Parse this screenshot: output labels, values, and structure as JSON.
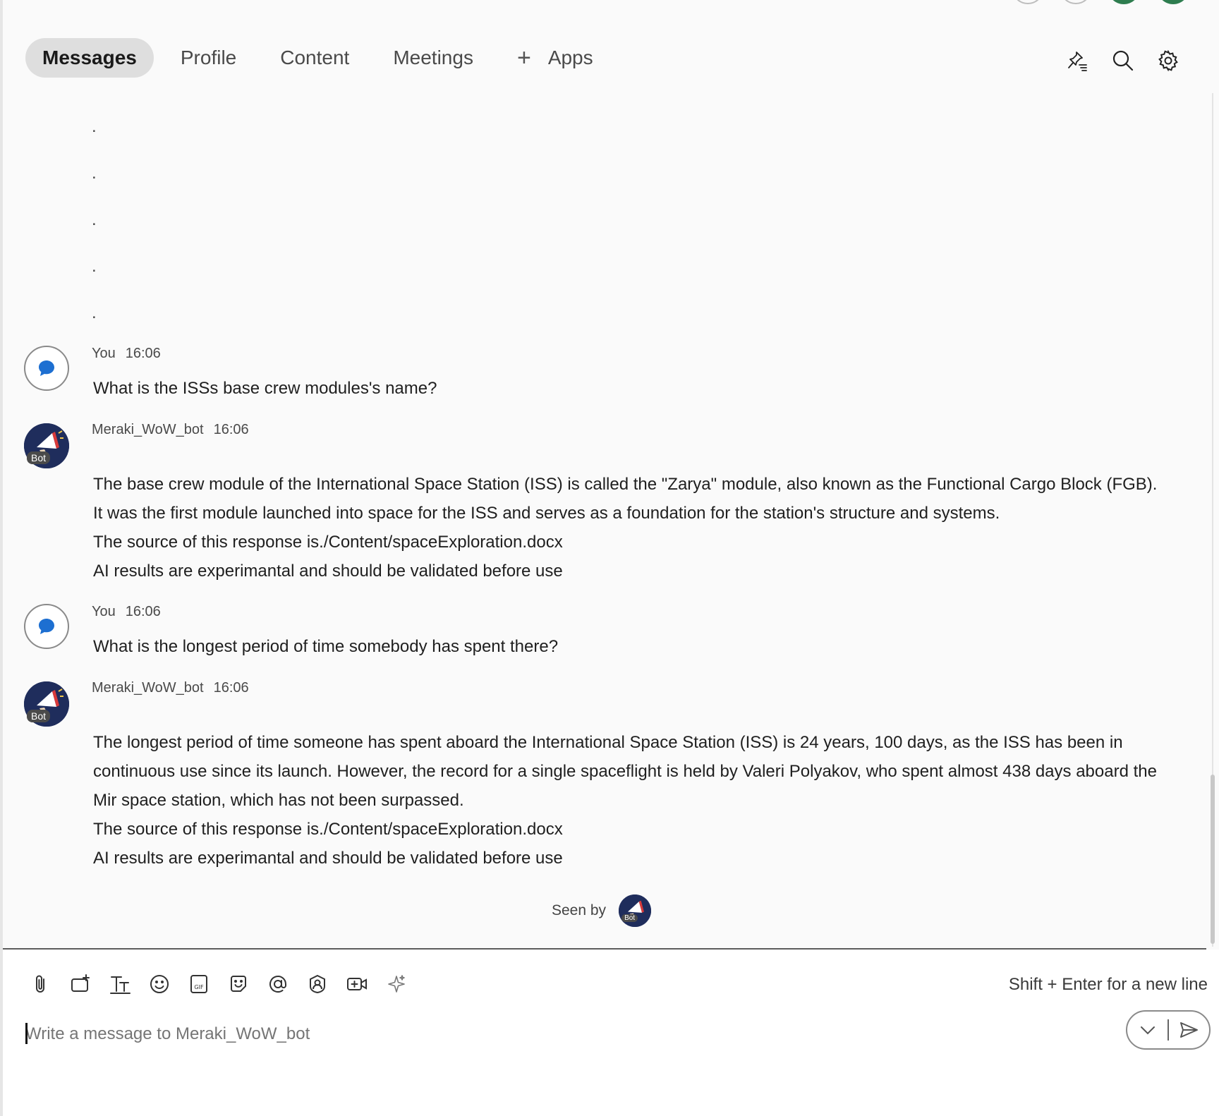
{
  "tabs": [
    {
      "label": "Messages",
      "active": true
    },
    {
      "label": "Profile"
    },
    {
      "label": "Content"
    },
    {
      "label": "Meetings"
    },
    {
      "label": "Apps"
    }
  ],
  "header_icons": [
    "pin-list-icon",
    "search-icon",
    "gear-icon"
  ],
  "dots": [
    ".",
    ".",
    ".",
    ".",
    "."
  ],
  "messages": [
    {
      "sender": "You",
      "time": "16:06",
      "lines": [
        "What is the ISSs base crew modules's name?"
      ]
    },
    {
      "sender": "Meraki_WoW_bot",
      "time": "16:06",
      "badge": "Bot",
      "lines": [
        "The base crew module of the International Space Station (ISS) is called the \"Zarya\" module, also known as the Functional Cargo Block (FGB). It was the first module launched into space for the ISS and serves as a foundation for the station's structure and systems.",
        "The source of this response is./Content/spaceExploration.docx",
        "AI results are experimantal and should be validated before use"
      ]
    },
    {
      "sender": "You",
      "time": "16:06",
      "lines": [
        "What is the longest period of time somebody has spent there?"
      ]
    },
    {
      "sender": "Meraki_WoW_bot",
      "time": "16:06",
      "badge": "Bot",
      "lines": [
        "The longest period of time someone has spent aboard the International Space Station (ISS) is 24 years, 100 days, as the ISS has been in continuous use since its launch. However, the record for a single spaceflight is held by Valeri Polyakov, who spent almost 438 days aboard the Mir space station, which has not been surpassed.",
        "The source of this response is./Content/spaceExploration.docx",
        "AI results are experimantal and should be validated before use"
      ]
    }
  ],
  "seen_by": {
    "label": "Seen by",
    "badge": "Bot"
  },
  "composer": {
    "hint": "Shift + Enter for a new line",
    "placeholder": "Write a message to Meraki_WoW_bot",
    "tools": [
      "attach-icon",
      "whiteboard-icon",
      "text-format-icon",
      "emoji-icon",
      "gif-icon",
      "sticker-icon",
      "mention-icon",
      "contact-icon",
      "add-video-icon",
      "ai-sparkle-icon"
    ]
  },
  "colors": {
    "bot_avatar": "#1f2d5c",
    "you_bubble": "#1d6fd1",
    "active_tab_bg": "#dedede"
  }
}
